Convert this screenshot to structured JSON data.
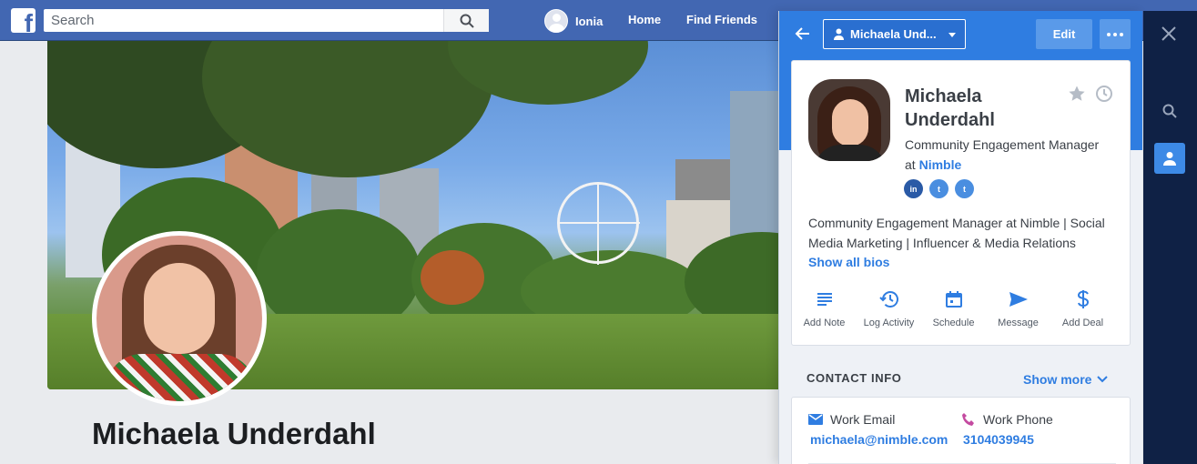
{
  "facebook": {
    "logo_letter": "f",
    "search": {
      "placeholder": "Search"
    },
    "user_name": "Ionia",
    "nav": [
      "Home",
      "Find Friends"
    ],
    "profile_name": "Michaela Underdahl",
    "colors": {
      "bar": "#4267b2"
    }
  },
  "panel": {
    "contact_select": "Michaela Und...",
    "edit_label": "Edit",
    "card": {
      "name": "Michaela Underdahl",
      "title": "Community Engagement Manager",
      "at_label": "at",
      "company": "Nimble",
      "socials": [
        {
          "icon": "linkedin-icon",
          "glyph": "in"
        },
        {
          "icon": "twitter-icon",
          "glyph": "t"
        },
        {
          "icon": "twitter-icon",
          "glyph": "t"
        }
      ],
      "bio": "Community Engagement Manager at Nimble | Social Media Marketing | Influencer & Media Relations",
      "show_bios": "Show all bios",
      "actions": [
        {
          "label": "Add Note",
          "icon": "note-icon"
        },
        {
          "label": "Log Activity",
          "icon": "history-icon"
        },
        {
          "label": "Schedule",
          "icon": "calendar-icon"
        },
        {
          "label": "Message",
          "icon": "send-icon"
        },
        {
          "label": "Add Deal",
          "icon": "dollar-icon"
        }
      ]
    },
    "contact_info": {
      "heading": "CONTACT INFO",
      "show_more": "Show more",
      "work_email_label": "Work Email",
      "work_email": "michaela@nimble.com",
      "work_phone_label": "Work Phone",
      "work_phone": "3104039945"
    },
    "colors": {
      "accent": "#2f7de1",
      "sidebar": "#0f2145"
    }
  }
}
